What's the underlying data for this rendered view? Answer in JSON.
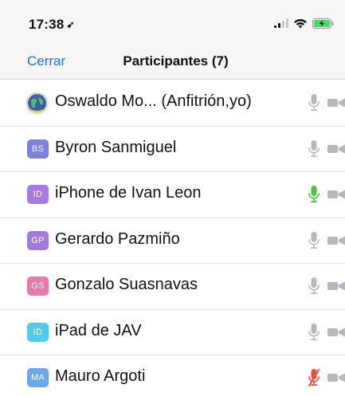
{
  "status_bar": {
    "time": "17:38",
    "location_glyph": "➶",
    "icons": [
      "signal-icon",
      "wifi-icon",
      "battery-charging-icon"
    ]
  },
  "nav": {
    "close_label": "Cerrar",
    "title": "Participantes (7)"
  },
  "colors": {
    "link": "#1f6fe0",
    "mic_muted_grey": "#b8b8bc",
    "mic_active": "#4cc236",
    "mic_off": "#ee4a3e"
  },
  "participants": [
    {
      "initials": "",
      "avatar_icon": "globe-avatar-icon",
      "name": "Oswaldo Mo...  (Anfitrión,yo)",
      "mic": "muted",
      "video": "off"
    },
    {
      "initials": "BS",
      "avatar_color": "#7b82d8",
      "name": "Byron Sanmiguel",
      "mic": "muted",
      "video": "off"
    },
    {
      "initials": "ID",
      "avatar_color": "#a57be0",
      "name": "iPhone de Ivan Leon",
      "mic": "active",
      "video": "off"
    },
    {
      "initials": "GP",
      "avatar_color": "#a27ad7",
      "name": "Gerardo Pazmiño",
      "mic": "muted",
      "video": "off"
    },
    {
      "initials": "GS",
      "avatar_color": "#e77aa7",
      "name": "Gonzalo Suasnavas",
      "mic": "muted",
      "video": "off"
    },
    {
      "initials": "ID",
      "avatar_color": "#56c9e8",
      "name": "iPad de JAV",
      "mic": "muted",
      "video": "off"
    },
    {
      "initials": "MA",
      "avatar_color": "#6ba8e8",
      "name": "Mauro Argoti",
      "mic": "off",
      "video": "off"
    }
  ]
}
